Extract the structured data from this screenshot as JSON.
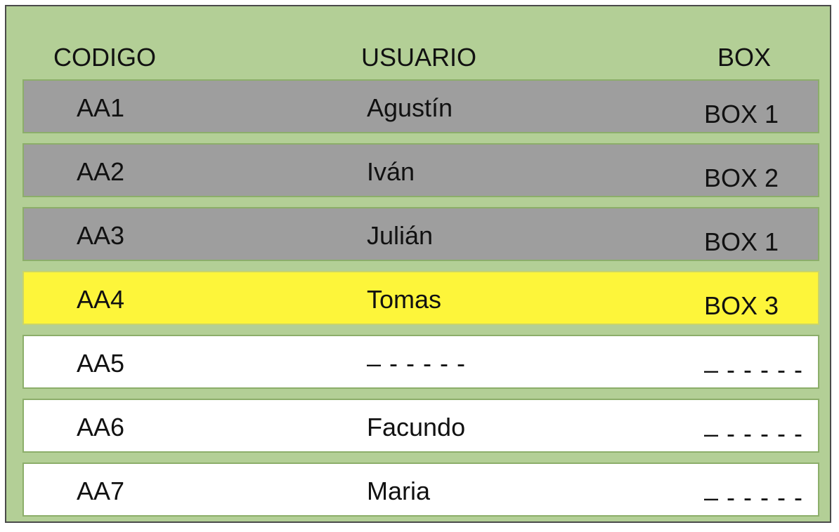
{
  "table": {
    "headers": {
      "codigo": "CODIGO",
      "usuario": "USUARIO",
      "box": "BOX"
    },
    "rows": [
      {
        "codigo": "AA1",
        "usuario": "Agustín",
        "box": "BOX 1",
        "status": "gray"
      },
      {
        "codigo": "AA2",
        "usuario": "Iván",
        "box": "BOX 2",
        "status": "gray"
      },
      {
        "codigo": "AA3",
        "usuario": "Julián",
        "box": "BOX 1",
        "status": "gray"
      },
      {
        "codigo": "AA4",
        "usuario": "Tomas",
        "box": "BOX 3",
        "status": "yellow"
      },
      {
        "codigo": "AA5",
        "usuario": "– - - - - -",
        "box": "– - - - - -",
        "status": "white"
      },
      {
        "codigo": "AA6",
        "usuario": "Facundo",
        "box": "– - - - - -",
        "status": "white"
      },
      {
        "codigo": "AA7",
        "usuario": "Maria",
        "box": "– - - - - -",
        "status": "white"
      }
    ]
  },
  "colors": {
    "panel": "#b3cf96",
    "gray_row": "#9e9e9e",
    "yellow_row": "#fdf53a",
    "white_row": "#ffffff"
  }
}
